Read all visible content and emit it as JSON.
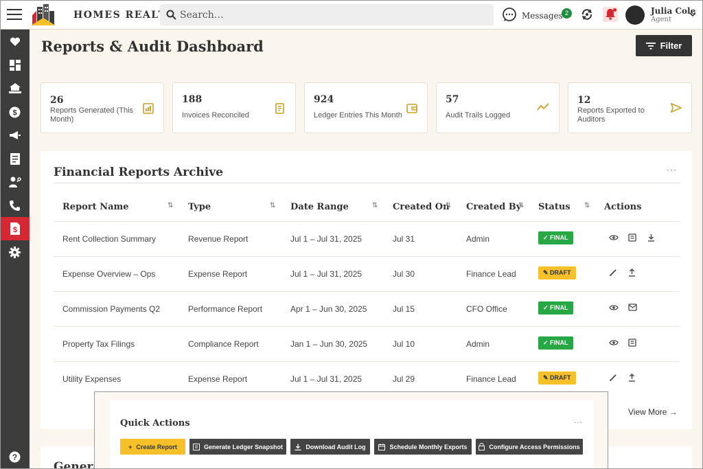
{
  "header": {
    "brand": "HOMES REALTY",
    "search_placeholder": "Search…",
    "messages_label": "Messages",
    "messages_count": "2",
    "user_name": "Julia Cole",
    "user_role": "Agent"
  },
  "sidebar": {
    "items": [
      "favorites",
      "dashboard",
      "properties",
      "finance",
      "marketing",
      "documents",
      "contacts",
      "calls",
      "reports",
      "settings",
      "help"
    ],
    "active": "reports"
  },
  "page": {
    "title": "Reports & Audit Dashboard",
    "filter_label": "Filter"
  },
  "stats": [
    {
      "value": "26",
      "label": "Reports Generated (This Month)"
    },
    {
      "value": "188",
      "label": "Invoices Reconciled"
    },
    {
      "value": "924",
      "label": "Ledger Entries This Month"
    },
    {
      "value": "57",
      "label": "Audit Trails Logged"
    },
    {
      "value": "12",
      "label": "Reports Exported to Auditors"
    }
  ],
  "archive": {
    "title": "Financial Reports Archive",
    "more": "···",
    "columns": [
      "Report Name",
      "Type",
      "Date Range",
      "Created On",
      "Created By",
      "Status",
      "Actions"
    ],
    "rows": [
      {
        "name": "Rent Collection Summary",
        "type": "Revenue Report",
        "range": "Jul 1 – Jul 31, 2025",
        "created_on": "Jul 31",
        "created_by": "Admin",
        "status": "FINAL"
      },
      {
        "name": "Expense Overview – Ops",
        "type": "Expense Report",
        "range": "Jul 1 – Jul 31, 2025",
        "created_on": "Jul 30",
        "created_by": "Finance Lead",
        "status": "DRAFT"
      },
      {
        "name": "Commission Payments Q2",
        "type": "Performance Report",
        "range": "Apr 1 – Jun 30, 2025",
        "created_on": "Jul 15",
        "created_by": "CFO Office",
        "status": "FINAL"
      },
      {
        "name": "Property Tax Filings",
        "type": "Compliance Report",
        "range": "Jan 1 – Jun 30, 2025",
        "created_on": "Jul 10",
        "created_by": "Admin",
        "status": "FINAL"
      },
      {
        "name": "Utility Expenses",
        "type": "Expense Report",
        "range": "Jul 1 – Jul 31, 2025",
        "created_on": "Jul 29",
        "created_by": "Finance Lead",
        "status": "DRAFT"
      }
    ],
    "view_more": "View More →"
  },
  "quick_actions": {
    "title": "Quick Actions",
    "more": "···",
    "buttons": [
      "Create Report",
      "Generate Ledger Snapshot",
      "Download Audit Log",
      "Schedule Monthly Exports",
      "Configure Access Permissions"
    ]
  },
  "next_section": {
    "title": "General"
  },
  "colors": {
    "accent_red": "#d62833",
    "final_green": "#27a844",
    "draft_yellow": "#f6c02b",
    "sidebar": "#3d3d3d",
    "background": "#faf6ee"
  }
}
